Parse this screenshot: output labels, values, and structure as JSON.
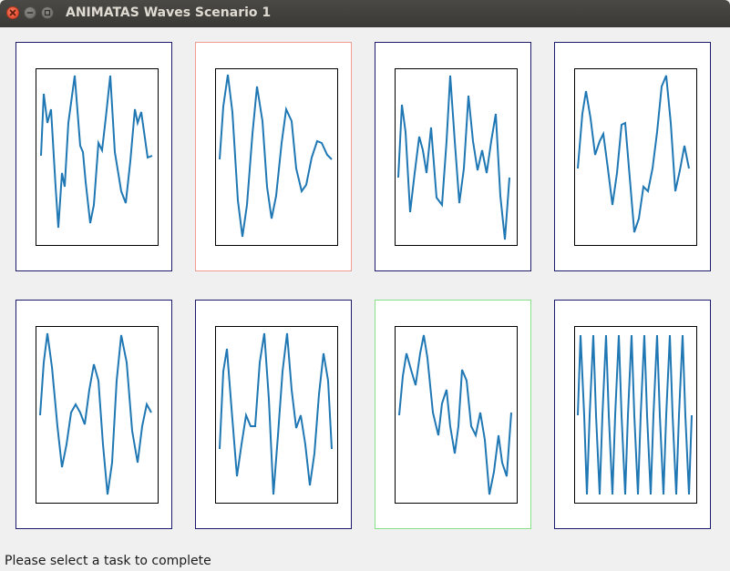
{
  "window": {
    "title": "ANIMATAS Waves Scenario 1"
  },
  "status_text": "Please select a task to complete",
  "colors": {
    "wave": "#1f77b4",
    "selected_red": "#f29b95",
    "selected_green": "#86e08a",
    "card_border": "#1a1a6e"
  },
  "cards": [
    {
      "id": "task-1",
      "state": "normal",
      "icon": "wave-plot"
    },
    {
      "id": "task-2",
      "state": "selected-red",
      "icon": "wave-plot"
    },
    {
      "id": "task-3",
      "state": "normal",
      "icon": "wave-plot"
    },
    {
      "id": "task-4",
      "state": "normal",
      "icon": "wave-plot"
    },
    {
      "id": "task-5",
      "state": "normal",
      "icon": "wave-plot"
    },
    {
      "id": "task-6",
      "state": "normal",
      "icon": "wave-plot"
    },
    {
      "id": "task-7",
      "state": "selected-green",
      "icon": "wave-plot"
    },
    {
      "id": "task-8",
      "state": "normal",
      "icon": "wave-plot"
    }
  ]
}
